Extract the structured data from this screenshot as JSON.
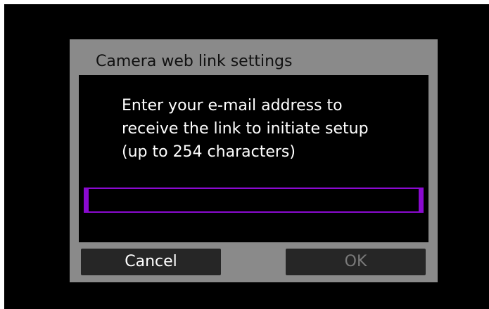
{
  "dialog": {
    "title": "Camera web link settings",
    "message_lines": [
      "Enter your e-mail address to",
      "receive the link to initiate setup",
      "(up to 254 characters)"
    ],
    "email_value": "",
    "cancel_label": "Cancel",
    "ok_label": "OK"
  },
  "colors": {
    "screen_background": "#000000",
    "dialog_frame": "#8a8a8a",
    "input_border_accent": "#8a0ad0",
    "button_background": "#262626",
    "ok_disabled_text": "#7a7a7a"
  }
}
